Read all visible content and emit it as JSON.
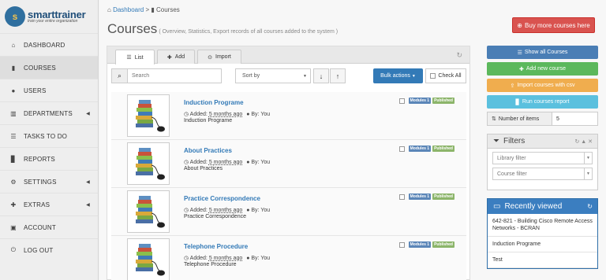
{
  "logo": {
    "brand": "smarttrainer",
    "tagline": "train your entire organization"
  },
  "sidebar": {
    "items": [
      {
        "label": "DASHBOARD",
        "icon": "dashboard-icon",
        "glyph": "⌂",
        "caret": false
      },
      {
        "label": "COURSES",
        "icon": "book-icon",
        "glyph": "▮",
        "caret": false
      },
      {
        "label": "USERS",
        "icon": "user-icon",
        "glyph": "●",
        "caret": false
      },
      {
        "label": "DEPARTMENTS",
        "icon": "bank-icon",
        "glyph": "▥",
        "caret": true
      },
      {
        "label": "TASKS TO DO",
        "icon": "tasks-icon",
        "glyph": "☰",
        "caret": false
      },
      {
        "label": "REPORTS",
        "icon": "bar-chart-icon",
        "glyph": "▊",
        "caret": false
      },
      {
        "label": "SETTINGS",
        "icon": "gears-icon",
        "glyph": "⚙",
        "caret": true
      },
      {
        "label": "EXTRAS",
        "icon": "plus-icon",
        "glyph": "✚",
        "caret": true
      },
      {
        "label": "ACCOUNT",
        "icon": "lock-icon",
        "glyph": "▣",
        "caret": false
      },
      {
        "label": "LOG OUT",
        "icon": "power-icon",
        "glyph": "⏻",
        "caret": false
      }
    ]
  },
  "breadcrumb": {
    "home": "Dashboard",
    "sep": ">",
    "current": "Courses"
  },
  "page": {
    "title": "Courses",
    "subtitle": "( Overview, Statistics, Export records of all courses added to the system )",
    "buy_label": "Buy more courses here"
  },
  "tabs": {
    "list": "List",
    "add": "Add",
    "import": "Import"
  },
  "toolbar": {
    "search_placeholder": "Search",
    "sort_label": "Sort by",
    "bulk_label": "Bulk actions",
    "check_all": "Check All"
  },
  "courses": [
    {
      "title": "Induction Programe",
      "added": "Added:",
      "ago": "5 months ago",
      "by": "By:",
      "author": "You",
      "desc": "Induction Programe",
      "modules": "Modules 1",
      "status": "Published"
    },
    {
      "title": "About Practices",
      "added": "Added:",
      "ago": "5 months ago",
      "by": "By:",
      "author": "You",
      "desc": "About Practices",
      "modules": "Modules 1",
      "status": "Published"
    },
    {
      "title": "Practice Correspondence",
      "added": "Added:",
      "ago": "5 months ago",
      "by": "By:",
      "author": "You",
      "desc": "Practice Correspondence",
      "modules": "Modules 1",
      "status": "Published"
    },
    {
      "title": "Telephone Procedure",
      "added": "Added:",
      "ago": "5 months ago",
      "by": "By:",
      "author": "You",
      "desc": "Telephone Procedure",
      "modules": "Modules 1",
      "status": "Published"
    }
  ],
  "right": {
    "show_all": "Show all Courses",
    "add_new": "Add new course",
    "import_csv": "Import courses with csv",
    "run_report": "Run courses report",
    "num_items_label": "Number of items",
    "num_items_value": "5",
    "filters_title": "Filters",
    "library_filter": "Library filter",
    "course_filter": "Course filter",
    "recent_title": "Recently viewed",
    "recent": [
      "642-821 - Building Cisco Remote Access Networks - BCRAN",
      "Induction Programe",
      "Test"
    ]
  },
  "colors": {
    "primary": "#337ab7",
    "success": "#5cb85c",
    "warning": "#f0ad4e",
    "info": "#5bc0de",
    "danger": "#d9534f",
    "steel": "#4a7eb5"
  }
}
